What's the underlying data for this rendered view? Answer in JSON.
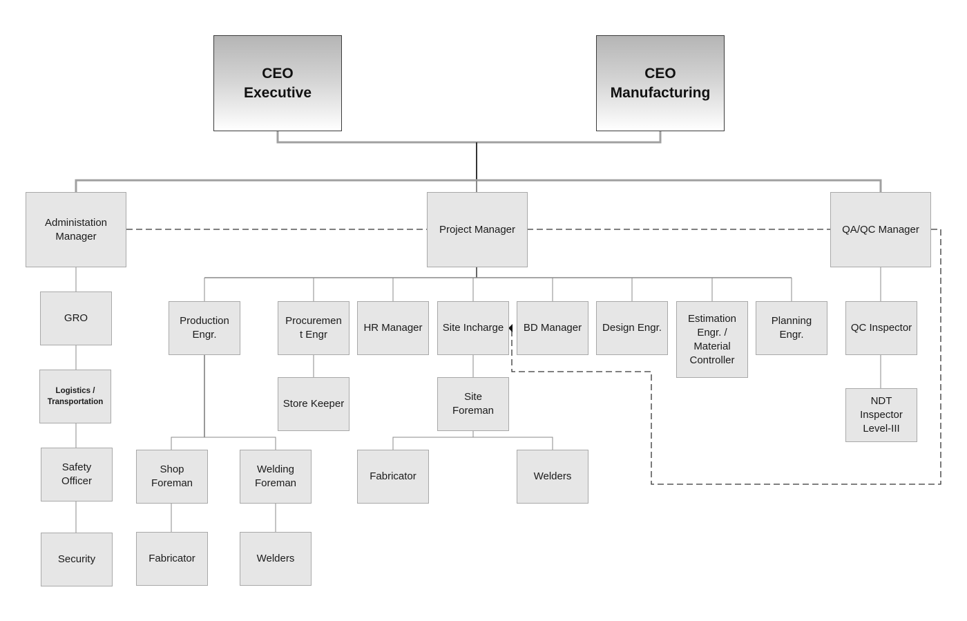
{
  "diagram": {
    "type": "org-chart",
    "colors": {
      "box_fill": "#e6e6e6",
      "box_border": "#a8a8a8",
      "ceo_gradient_top": "#b5b5b5",
      "ceo_gradient_bottom": "#ffffff",
      "connector": "#8a8a8a",
      "dashed_connector": "#333333"
    },
    "nodes": {
      "ceo_executive": "CEO\nExecutive",
      "ceo_manufacturing": "CEO\nManufacturing",
      "admin_manager": "Administation\nManager",
      "project_manager": "Project Manager",
      "qaqc_manager": "QA/QC Manager",
      "gro": "GRO",
      "logistics": "Logistics /\nTransportation",
      "safety_officer": "Safety\nOfficer",
      "security": "Security",
      "production_engr": "Production\nEngr.",
      "procurement_engr": "Procuremen\nt Engr",
      "hr_manager": "HR Manager",
      "site_incharge": "Site Incharge",
      "bd_manager": "BD Manager",
      "design_engr": "Design Engr.",
      "estimation_engr": "Estimation\nEngr. /\nMaterial\nController",
      "planning_engr": "Planning\nEngr.",
      "qc_inspector": "QC Inspector",
      "ndt_inspector": "NDT\nInspector\nLevel-III",
      "store_keeper": "Store Keeper",
      "site_foreman": "Site\nForeman",
      "shop_foreman": "Shop\nForeman",
      "welding_foreman": "Welding\nForeman",
      "fabricator_shop": "Fabricator",
      "welders_shop": "Welders",
      "fabricator_site": "Fabricator",
      "welders_site": "Welders"
    },
    "edges": [
      {
        "from": "ceo_executive",
        "to": "project_manager",
        "style": "solid"
      },
      {
        "from": "ceo_manufacturing",
        "to": "project_manager",
        "style": "solid"
      },
      {
        "from": "ceo_executive",
        "to": "admin_manager",
        "style": "solid"
      },
      {
        "from": "ceo_executive",
        "to": "qaqc_manager",
        "style": "solid"
      },
      {
        "from": "admin_manager",
        "to": "gro",
        "style": "solid"
      },
      {
        "from": "gro",
        "to": "logistics",
        "style": "solid"
      },
      {
        "from": "logistics",
        "to": "safety_officer",
        "style": "solid"
      },
      {
        "from": "safety_officer",
        "to": "security",
        "style": "solid"
      },
      {
        "from": "project_manager",
        "to": "production_engr",
        "style": "solid"
      },
      {
        "from": "project_manager",
        "to": "procurement_engr",
        "style": "solid"
      },
      {
        "from": "project_manager",
        "to": "hr_manager",
        "style": "solid"
      },
      {
        "from": "project_manager",
        "to": "site_incharge",
        "style": "solid"
      },
      {
        "from": "project_manager",
        "to": "bd_manager",
        "style": "solid"
      },
      {
        "from": "project_manager",
        "to": "design_engr",
        "style": "solid"
      },
      {
        "from": "project_manager",
        "to": "estimation_engr",
        "style": "solid"
      },
      {
        "from": "project_manager",
        "to": "planning_engr",
        "style": "solid"
      },
      {
        "from": "procurement_engr",
        "to": "store_keeper",
        "style": "solid"
      },
      {
        "from": "production_engr",
        "to": "shop_foreman",
        "style": "solid"
      },
      {
        "from": "production_engr",
        "to": "welding_foreman",
        "style": "solid"
      },
      {
        "from": "shop_foreman",
        "to": "fabricator_shop",
        "style": "solid"
      },
      {
        "from": "welding_foreman",
        "to": "welders_shop",
        "style": "solid"
      },
      {
        "from": "site_incharge",
        "to": "site_foreman",
        "style": "solid"
      },
      {
        "from": "site_foreman",
        "to": "fabricator_site",
        "style": "solid"
      },
      {
        "from": "site_foreman",
        "to": "welders_site",
        "style": "solid"
      },
      {
        "from": "qaqc_manager",
        "to": "qc_inspector",
        "style": "solid"
      },
      {
        "from": "qc_inspector",
        "to": "ndt_inspector",
        "style": "solid"
      },
      {
        "from": "admin_manager",
        "to": "project_manager",
        "style": "dashed"
      },
      {
        "from": "project_manager",
        "to": "qaqc_manager",
        "style": "dashed"
      },
      {
        "from": "qaqc_manager",
        "to": "site_incharge",
        "style": "dashed-arrow"
      }
    ]
  }
}
